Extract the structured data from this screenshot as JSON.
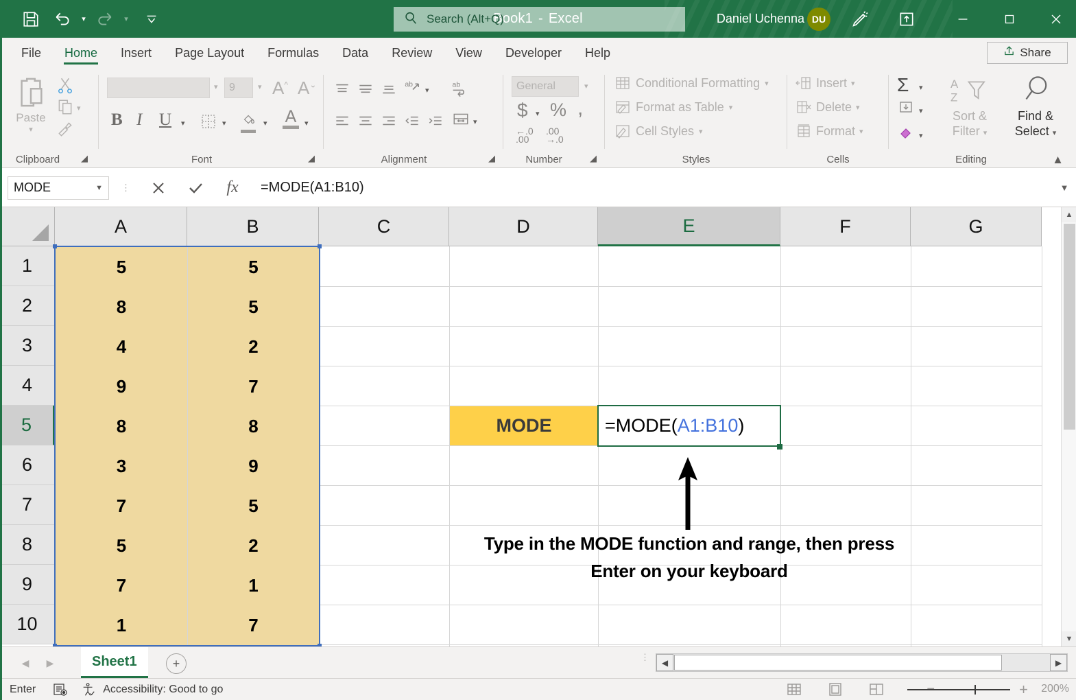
{
  "titlebar": {
    "quick_access": [
      {
        "name": "save",
        "label": "Save"
      },
      {
        "name": "undo",
        "label": "Undo"
      },
      {
        "name": "redo",
        "label": "Redo"
      },
      {
        "name": "customize",
        "label": "Customize Quick Access Toolbar"
      }
    ],
    "document_name": "Book1",
    "separator": "-",
    "app_name": "Excel",
    "search_placeholder": "Search (Alt+Q)",
    "user_name": "Daniel Uchenna",
    "user_initials": "DU",
    "pen_label": "Draw",
    "ribbon_display_label": "Ribbon Display Options",
    "minimize_label": "Minimize",
    "maximize_label": "Restore Down",
    "close_label": "Close"
  },
  "tabs": {
    "items": [
      {
        "label": "File",
        "active": false
      },
      {
        "label": "Home",
        "active": true
      },
      {
        "label": "Insert",
        "active": false
      },
      {
        "label": "Page Layout",
        "active": false
      },
      {
        "label": "Formulas",
        "active": false
      },
      {
        "label": "Data",
        "active": false
      },
      {
        "label": "Review",
        "active": false
      },
      {
        "label": "View",
        "active": false
      },
      {
        "label": "Developer",
        "active": false
      },
      {
        "label": "Help",
        "active": false
      }
    ],
    "share_label": "Share"
  },
  "ribbon": {
    "clipboard": {
      "label": "Clipboard",
      "paste_label": "Paste",
      "cut_label": "Cut",
      "copy_label": "Copy",
      "format_painter_label": "Format Painter"
    },
    "font": {
      "label": "Font",
      "font_name_value": "",
      "font_size_value": "9",
      "grow_font_label": "A",
      "shrink_font_label": "A",
      "bold_label": "B",
      "italic_label": "I",
      "underline_label": "U",
      "borders_label": "Borders",
      "fill_color_label": "Fill Color",
      "font_color_label": "A"
    },
    "alignment": {
      "label": "Alignment",
      "top_align_label": "Top Align",
      "middle_align_label": "Middle Align",
      "bottom_align_label": "Bottom Align",
      "orientation_label": "Orientation",
      "align_left_label": "Align Left",
      "center_label": "Center",
      "align_right_label": "Align Right",
      "decrease_indent_label": "Decrease Indent",
      "increase_indent_label": "Increase Indent",
      "wrap_text_label": "Wrap Text",
      "merge_center_label": "Merge & Center"
    },
    "number": {
      "label": "Number",
      "format_value": "General",
      "accounting_label": "$",
      "percent_label": "%",
      "comma_label": ",",
      "increase_decimal_label": "Increase Decimal",
      "decrease_decimal_label": "Decrease Decimal"
    },
    "styles": {
      "label": "Styles",
      "items": [
        {
          "label": "Conditional Formatting"
        },
        {
          "label": "Format as Table"
        },
        {
          "label": "Cell Styles"
        }
      ]
    },
    "cells": {
      "label": "Cells",
      "items": [
        {
          "label": "Insert"
        },
        {
          "label": "Delete"
        },
        {
          "label": "Format"
        }
      ]
    },
    "editing": {
      "label": "Editing",
      "autosum_label": "AutoSum",
      "fill_label": "Fill",
      "clear_label": "Clear",
      "sort_filter_line1": "Sort &",
      "sort_filter_line2": "Filter",
      "find_select_line1": "Find &",
      "find_select_line2": "Select"
    },
    "collapse_label": "Collapse the Ribbon"
  },
  "formula_bar": {
    "name_box_value": "MODE",
    "cancel_label": "Cancel",
    "enter_label": "Enter",
    "insert_function_label": "fx",
    "formula_value": "=MODE(A1:B10)",
    "expand_label": "Expand Formula Bar"
  },
  "grid": {
    "columns": [
      "A",
      "B",
      "C",
      "D",
      "E",
      "F",
      "G"
    ],
    "selected_column": "E",
    "rows": [
      "1",
      "2",
      "3",
      "4",
      "5",
      "6",
      "7",
      "8",
      "9",
      "10"
    ],
    "selected_row": "5",
    "data": {
      "A": [
        "5",
        "8",
        "4",
        "9",
        "8",
        "3",
        "7",
        "5",
        "7",
        "1"
      ],
      "B": [
        "5",
        "5",
        "2",
        "7",
        "8",
        "9",
        "5",
        "2",
        "1",
        "7"
      ]
    },
    "label_cell": {
      "ref": "D5",
      "value": "MODE"
    },
    "active_cell": {
      "ref": "E5",
      "formula_prefix": "=MODE(",
      "formula_range": "A1:B10",
      "formula_suffix": ")"
    },
    "annotation": {
      "line1": "Type in the MODE function and range, then press",
      "line2": "Enter on your keyboard"
    },
    "selected_range": "A1:B10"
  },
  "sheet_bar": {
    "prev_label": "Previous Sheet",
    "next_label": "Next Sheet",
    "sheets": [
      {
        "label": "Sheet1",
        "active": true
      }
    ],
    "add_sheet_label": "New sheet"
  },
  "status_bar": {
    "mode": "Enter",
    "macro_label": "Record Macro",
    "accessibility": "Accessibility: Good to go",
    "view_normal_label": "Normal",
    "view_page_layout_label": "Page Layout",
    "view_page_break_label": "Page Break Preview",
    "zoom_out_label": "Zoom Out",
    "zoom_in_label": "Zoom In",
    "zoom_level": "200%"
  },
  "colors": {
    "brand_green": "#217346",
    "range_fill": "#efd9a0",
    "label_fill": "#fed049",
    "range_border": "#3f6ebd",
    "formula_ref": "#4472dd",
    "avatar": "#7e8a00"
  }
}
